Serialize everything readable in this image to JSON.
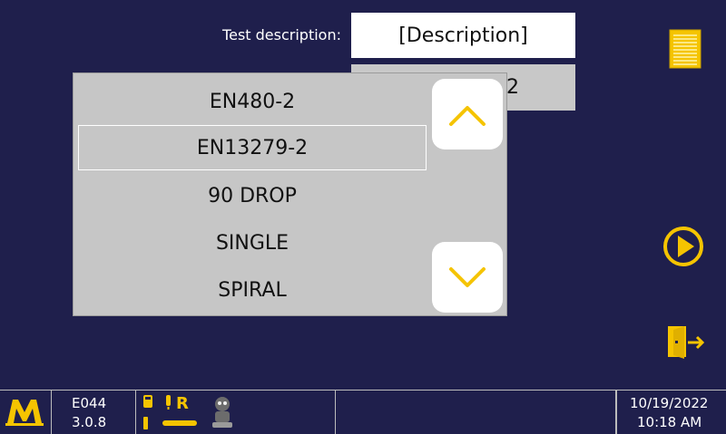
{
  "form": {
    "description_label": "Test description:",
    "description_value": "[Description]",
    "standard_partial_value": "2"
  },
  "list": {
    "items": [
      "EN480-2",
      "EN13279-2",
      "90 DROP",
      "SINGLE",
      "SPIRAL"
    ],
    "selected_index": 1
  },
  "status_bar": {
    "device_code": "E044",
    "version": "3.0.8",
    "date": "10/19/2022",
    "time": "10:18 AM",
    "status_letter": "R"
  },
  "icons": {
    "notes": "notes-icon",
    "play": "play-circle-icon",
    "exit": "exit-door-icon",
    "scroll_up": "chevron-up-icon",
    "scroll_down": "chevron-down-icon",
    "logo": "brand-logo-icon"
  },
  "colors": {
    "background": "#1f1f4c",
    "accent": "#f5c400",
    "list_bg": "#c6c6c6"
  }
}
